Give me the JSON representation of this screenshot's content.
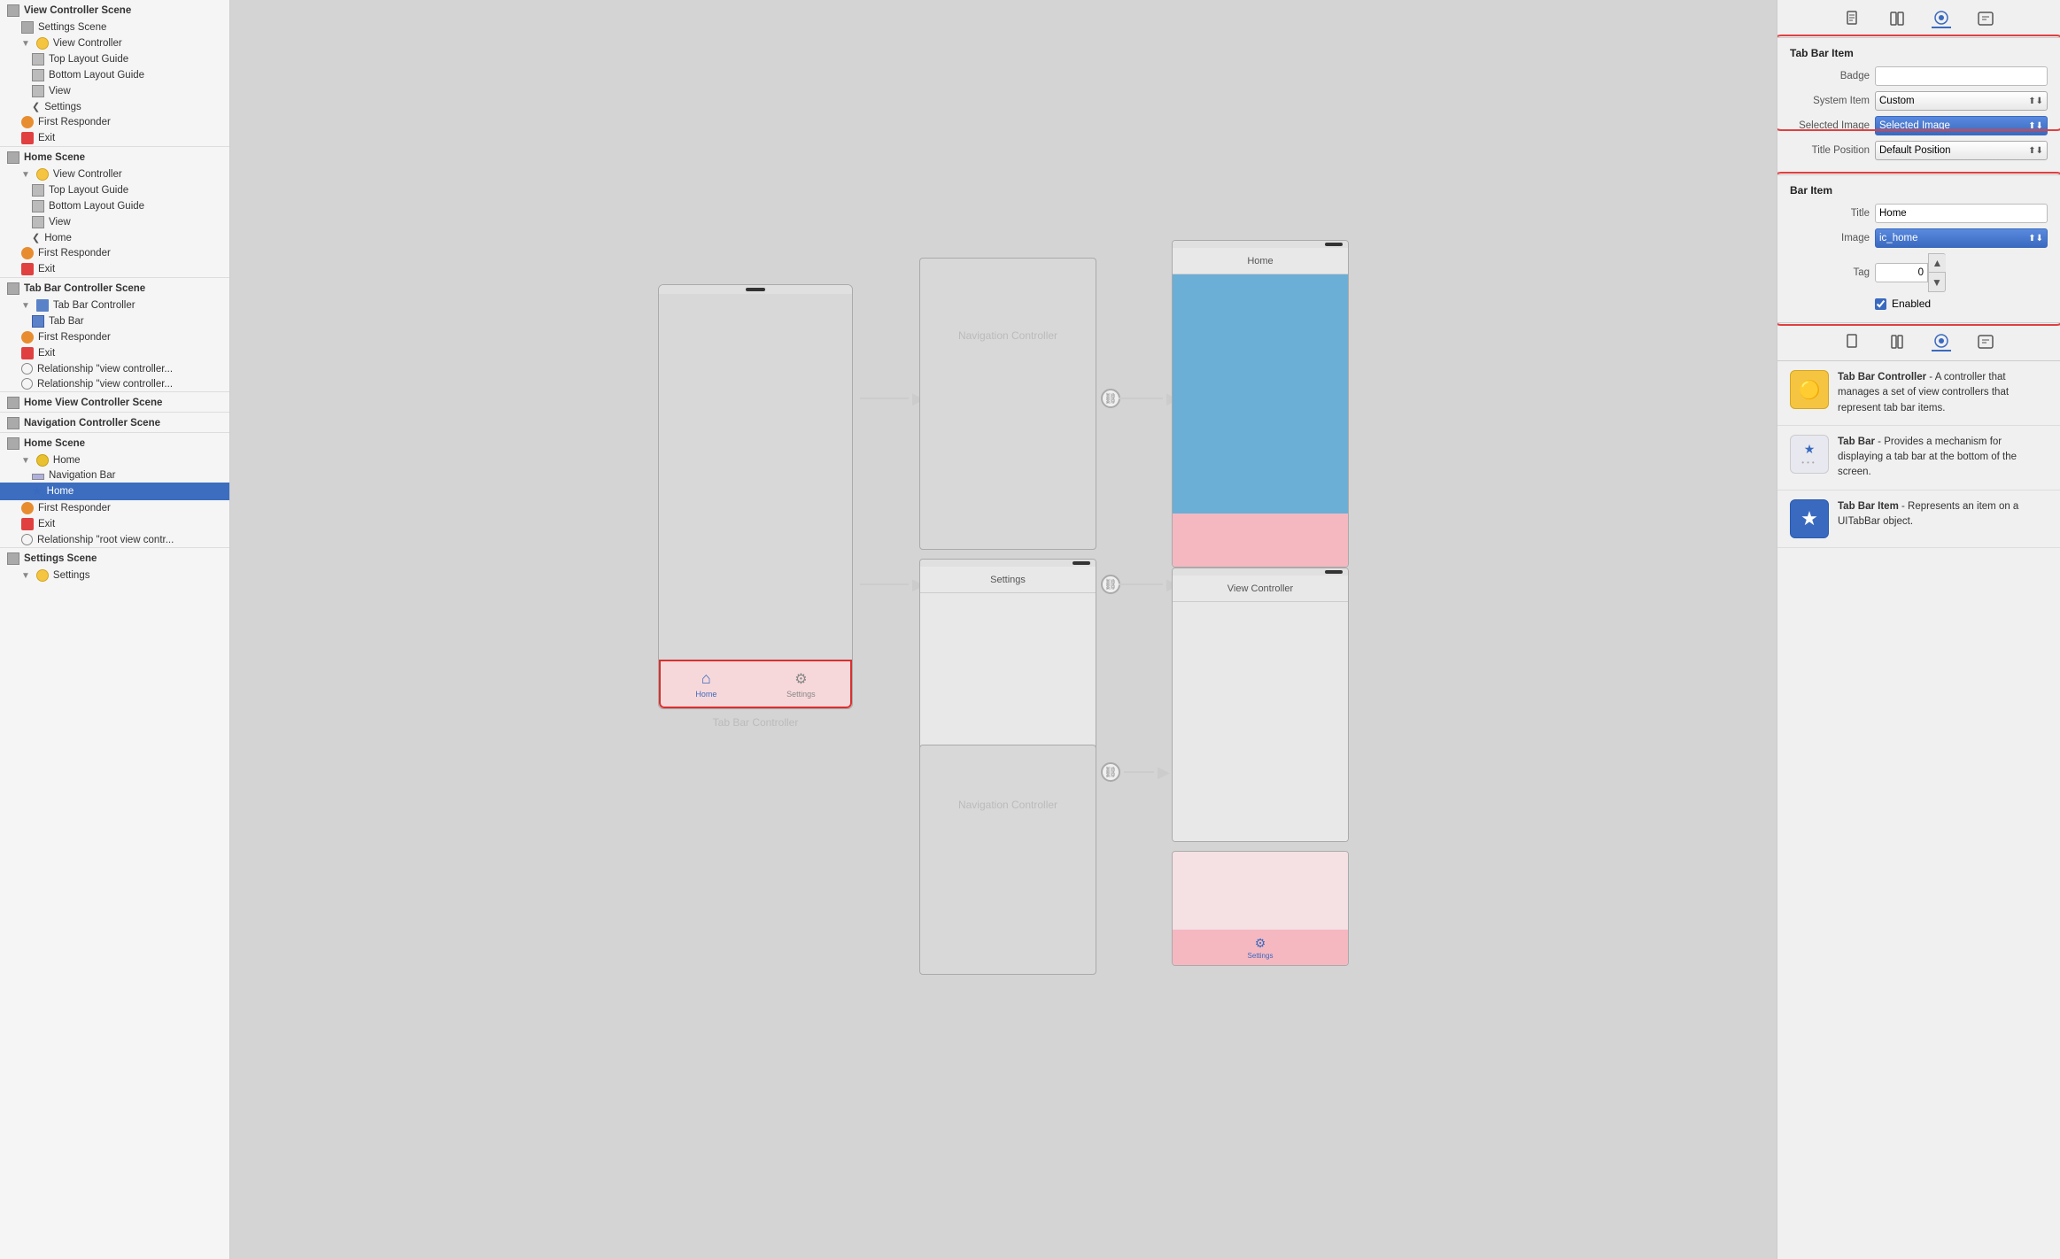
{
  "sidebar": {
    "scenes": [
      {
        "name": "View Controller Scene",
        "icon": "scene",
        "items": [
          {
            "label": "Settings Scene",
            "icon": "scene",
            "indent": 0
          },
          {
            "label": "▼ View Controller",
            "icon": "yellow-circle",
            "indent": 1
          },
          {
            "label": "Top Layout Guide",
            "icon": "square",
            "indent": 2
          },
          {
            "label": "Bottom Layout Guide",
            "icon": "square",
            "indent": 2
          },
          {
            "label": "View",
            "icon": "square",
            "indent": 2
          },
          {
            "label": "< Settings",
            "icon": "home-arrow",
            "indent": 2
          },
          {
            "label": "First Responder",
            "icon": "orange-circle",
            "indent": 1
          },
          {
            "label": "Exit",
            "icon": "red-rect",
            "indent": 1
          }
        ]
      },
      {
        "name": "Home Scene",
        "icon": "scene",
        "items": [
          {
            "label": "▼ View Controller",
            "icon": "yellow-circle",
            "indent": 1
          },
          {
            "label": "Top Layout Guide",
            "icon": "square",
            "indent": 2
          },
          {
            "label": "Bottom Layout Guide",
            "icon": "square",
            "indent": 2
          },
          {
            "label": "View",
            "icon": "square",
            "indent": 2
          },
          {
            "label": "< Home",
            "icon": "home-arrow",
            "indent": 2
          },
          {
            "label": "First Responder",
            "icon": "orange-circle",
            "indent": 1
          },
          {
            "label": "Exit",
            "icon": "red-rect",
            "indent": 1
          }
        ]
      },
      {
        "name": "Tab Bar Controller Scene",
        "icon": "scene",
        "items": [
          {
            "label": "▼ Tab Bar Controller",
            "icon": "tab-grid",
            "indent": 1
          },
          {
            "label": "Tab Bar",
            "icon": "tab-bar-item",
            "indent": 2
          },
          {
            "label": "First Responder",
            "icon": "orange-circle",
            "indent": 1
          },
          {
            "label": "Exit",
            "icon": "red-rect",
            "indent": 1
          },
          {
            "label": "Relationship \"view controller...",
            "icon": "circle-outline",
            "indent": 1
          },
          {
            "label": "Relationship \"view controller...",
            "icon": "circle-outline",
            "indent": 1
          }
        ]
      },
      {
        "name": "Home View Controller Scene",
        "icon": "scene",
        "items": []
      },
      {
        "name": "Navigation Controller Scene",
        "icon": "scene",
        "items": []
      },
      {
        "name": "Home Scene",
        "icon": "scene",
        "items": [
          {
            "label": "▼ Home",
            "icon": "yellow-circle-nav",
            "indent": 1
          },
          {
            "label": "Navigation Bar",
            "icon": "nav-bar",
            "indent": 2
          },
          {
            "label": "★ Home",
            "icon": "star",
            "indent": 2,
            "selected": true
          },
          {
            "label": "First Responder",
            "icon": "orange-circle",
            "indent": 1
          },
          {
            "label": "Exit",
            "icon": "red-rect",
            "indent": 1
          },
          {
            "label": "Relationship \"root view contr...",
            "icon": "circle-outline",
            "indent": 1
          }
        ]
      },
      {
        "name": "Settings Scene",
        "icon": "scene",
        "items": [
          {
            "label": "▼ Settings",
            "icon": "yellow-circle",
            "indent": 1
          }
        ]
      }
    ]
  },
  "canvas": {
    "tab_bar_controller_label": "Tab Bar Controller",
    "navigation_controller_label": "Navigation Controller",
    "home_title": "Home",
    "settings_title": "Settings",
    "view_controller_title": "View Controller",
    "tab_home_label": "Home",
    "tab_settings_label": "Settings"
  },
  "inspector": {
    "header": "Tab Bar Item",
    "badge_label": "Badge",
    "badge_value": "",
    "system_item_label": "System Item",
    "system_item_value": "Custom",
    "selected_image_label": "Selected Image",
    "selected_image_placeholder": "Selected Image",
    "title_position_label": "Title Position",
    "title_position_value": "Default Position",
    "bar_item_header": "Bar Item",
    "title_label": "Title",
    "title_value": "Home",
    "image_label": "Image",
    "image_value": "ic_home",
    "tag_label": "Tag",
    "tag_value": "0",
    "enabled_label": "Enabled",
    "enabled_checked": true
  },
  "help_items": [
    {
      "icon": "🟡",
      "icon_bg": "#f5c542",
      "title": "Tab Bar Controller",
      "description": "A controller that manages a set of view controllers that represent tab bar items."
    },
    {
      "icon": "⭐",
      "icon_bg": "#e8e8f5",
      "title": "Tab Bar",
      "description": "Provides a mechanism for displaying a tab bar at the bottom of the screen."
    },
    {
      "icon": "⭐",
      "icon_bg": "#3a6abf",
      "title": "Tab Bar Item",
      "description": "Represents an item on a UITabBar object."
    }
  ]
}
